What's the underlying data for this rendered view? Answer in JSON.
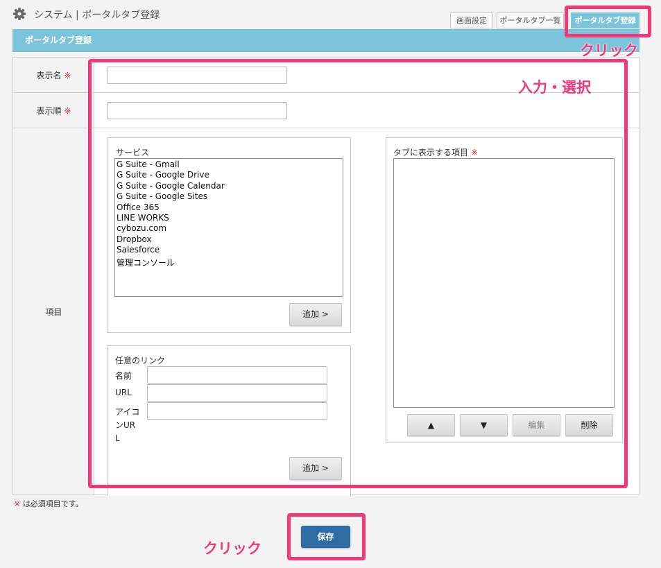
{
  "header": {
    "title": "システム | ポータルタブ登録",
    "tabs": [
      {
        "label": "画面設定"
      },
      {
        "label": "ポータルタブ一覧"
      },
      {
        "label": "ポータルタブ登録"
      }
    ]
  },
  "section": {
    "title": "ポータルタブ登録"
  },
  "form": {
    "display_name_label": "表示名",
    "display_order_label": "表示順",
    "items_label": "項目",
    "required_mark": "※",
    "display_name_value": "",
    "display_order_value": ""
  },
  "services": {
    "title": "サービス",
    "options": [
      "G Suite - Gmail",
      "G Suite - Google Drive",
      "G Suite - Google Calendar",
      "G Suite - Google Sites",
      "Office 365",
      "LINE WORKS",
      "cybozu.com",
      "Dropbox",
      "Salesforce",
      "管理コンソール"
    ],
    "add_button": "追加 >"
  },
  "custom_link": {
    "title": "任意のリンク",
    "name_label": "名前",
    "url_label": "URL",
    "icon_url_label": "アイコンURL",
    "icon_url_lines": [
      "アイコ",
      "ンUR",
      "L"
    ],
    "add_button": "追加 >"
  },
  "tab_items": {
    "title": "タブに表示する項目",
    "up_button": "▲",
    "down_button": "▼",
    "edit_button": "編集",
    "delete_button": "削除"
  },
  "footer": {
    "required_note": " は必須項目です。",
    "save_button": "保存"
  },
  "annotations": {
    "click_top": "クリック",
    "input_select": "入力・選択",
    "click_bottom": "クリック"
  },
  "colors": {
    "accent": "#7bc4dc",
    "primary_button": "#2e6da4",
    "annotation": "#f1387a",
    "required": "#d0342c"
  }
}
